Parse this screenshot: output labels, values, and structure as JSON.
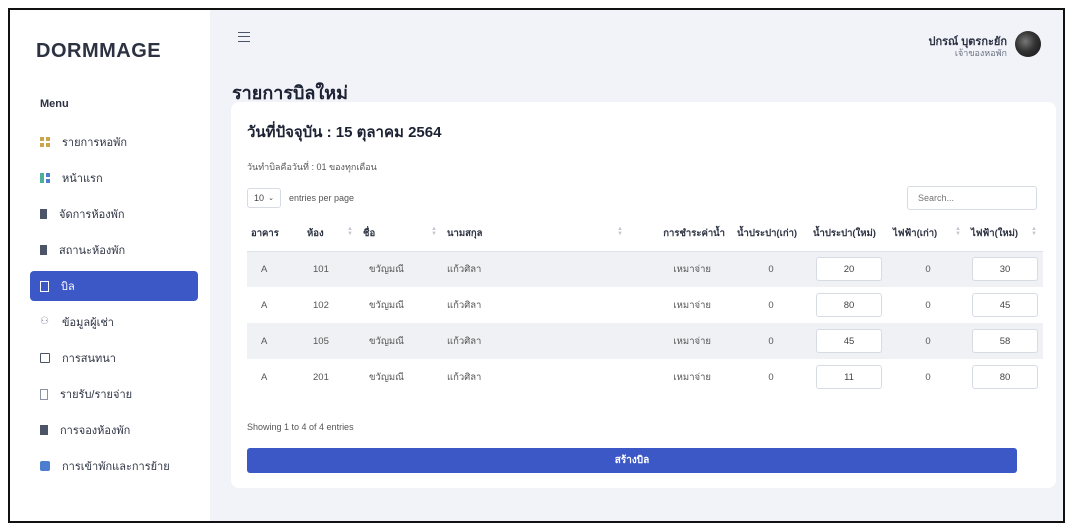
{
  "app": {
    "logo": "DORMMAGE"
  },
  "sidebar": {
    "menu_title": "Menu",
    "items": [
      {
        "label": "รายการหอพัก",
        "icon": "grid-icon"
      },
      {
        "label": "หน้าแรก",
        "icon": "home-icon"
      },
      {
        "label": "จัดการห้องพัก",
        "icon": "building-icon"
      },
      {
        "label": "สถานะห้องพัก",
        "icon": "building-icon"
      },
      {
        "label": "บิล",
        "icon": "document-icon",
        "active": true
      },
      {
        "label": "ข้อมูลผู้เช่า",
        "icon": "users-icon"
      },
      {
        "label": "การสนทนา",
        "icon": "chat-icon"
      },
      {
        "label": "รายรับ/รายจ่าย",
        "icon": "file-icon"
      },
      {
        "label": "การจองห้องพัก",
        "icon": "book-icon"
      },
      {
        "label": "การเข้าพักและการย้าย",
        "icon": "move-icon"
      }
    ]
  },
  "header": {
    "user_name": "ปกรณ์ บุตรกะยัก",
    "user_role": "เจ้าของหอพัก"
  },
  "page": {
    "title": "รายการบิลใหม่",
    "date_title": "วันที่ปัจจุบัน : 15 ตุลาคม 2564",
    "bill_note": "วันทำบิลคือวันที่ : 01 ของทุกเดือน",
    "per_page_value": "10",
    "per_page_label": "entries per page",
    "search_placeholder": "Search...",
    "showing_text": "Showing 1 to 4 of 4 entries",
    "create_button": "สร้างบิล"
  },
  "table": {
    "columns": [
      "อาคาร",
      "ห้อง",
      "ชื่อ",
      "นามสกุล",
      "การชำระค่าน้ำ",
      "น้ำประปา(เก่า)",
      "น้ำประปา(ใหม่)",
      "ไฟฟ้า(เก่า)",
      "ไฟฟ้า(ใหม่)"
    ],
    "rows": [
      {
        "building": "A",
        "room": "101",
        "first_name": "ขวัญมณี",
        "last_name": "แก้วศิลา",
        "water_payment": "เหมาจ่าย",
        "water_old": "0",
        "water_new": "20",
        "elec_old": "0",
        "elec_new": "30"
      },
      {
        "building": "A",
        "room": "102",
        "first_name": "ขวัญมณี",
        "last_name": "แก้วศิลา",
        "water_payment": "เหมาจ่าย",
        "water_old": "0",
        "water_new": "80",
        "elec_old": "0",
        "elec_new": "45"
      },
      {
        "building": "A",
        "room": "105",
        "first_name": "ขวัญมณี",
        "last_name": "แก้วศิลา",
        "water_payment": "เหมาจ่าย",
        "water_old": "0",
        "water_new": "45",
        "elec_old": "0",
        "elec_new": "58"
      },
      {
        "building": "A",
        "room": "201",
        "first_name": "ขวัญมณี",
        "last_name": "แก้วศิลา",
        "water_payment": "เหมาจ่าย",
        "water_old": "0",
        "water_new": "11",
        "elec_old": "0",
        "elec_new": "80"
      }
    ]
  }
}
